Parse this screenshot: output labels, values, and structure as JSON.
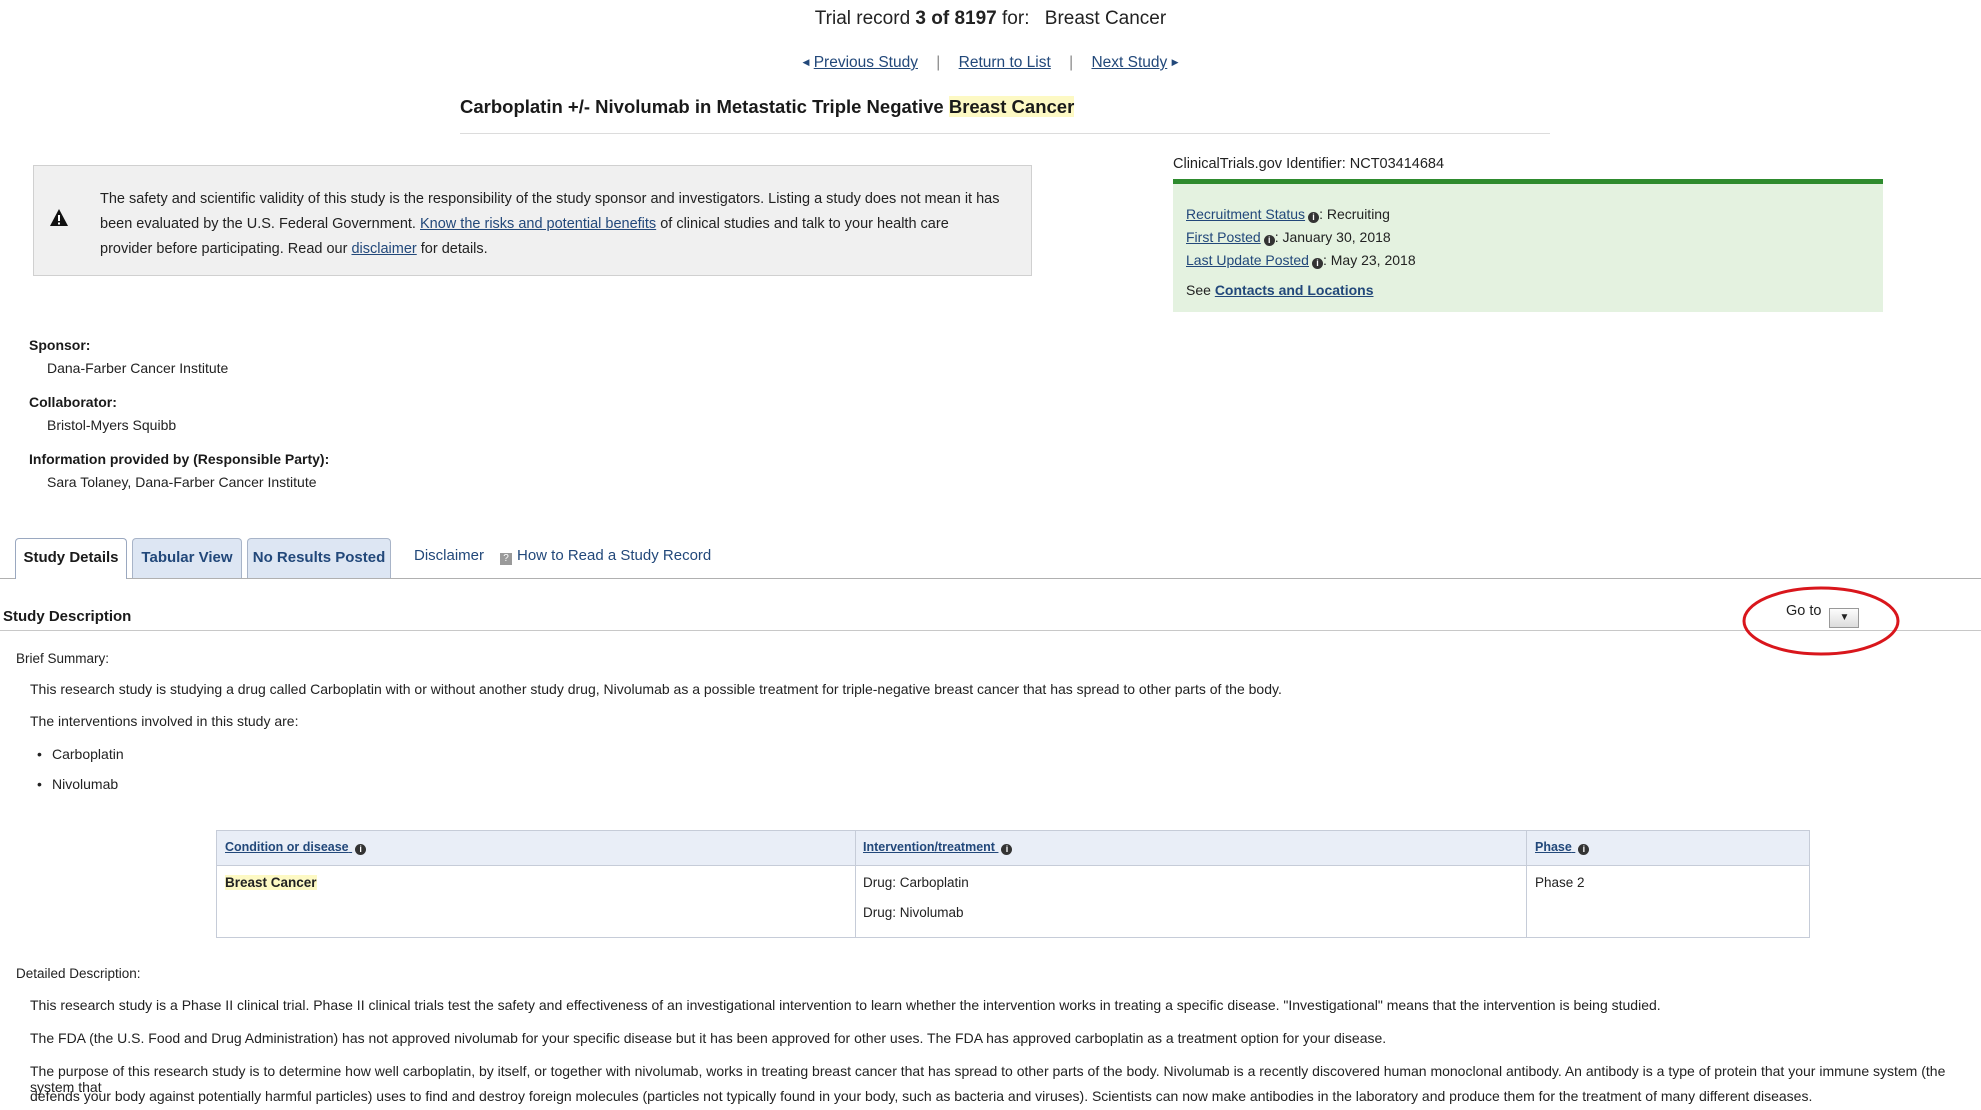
{
  "header": {
    "trial_prefix": "Trial record",
    "trial_count": "3 of 8197",
    "trial_for": "for:",
    "query": "Breast Cancer",
    "nav": {
      "previous": "Previous Study",
      "return": "Return to List",
      "next": "Next Study"
    },
    "title_main": "Carboplatin +/- Nivolumab in Metastatic Triple Negative",
    "title_highlight": "Breast Cancer"
  },
  "disclaimer": {
    "text_1": "The safety and scientific validity of this study is the responsibility of the study sponsor and investigators. Listing a study does not mean it has been evaluated by the U.S. Federal Government.",
    "link_risks": "Know the risks and potential benefits",
    "text_2": "of clinical studies and talk to your health care provider before participating. Read our",
    "link_disclaimer": "disclaimer",
    "text_3": "for details."
  },
  "status": {
    "identifier_label": "ClinicalTrials.gov Identifier:",
    "identifier": "NCT03414684",
    "recruitment_label": "Recruitment Status",
    "recruitment_value": "Recruiting",
    "first_posted_label": "First Posted",
    "first_posted_value": "January 30, 2018",
    "last_update_label": "Last Update Posted",
    "last_update_value": "May 23, 2018",
    "see_label": "See",
    "contacts_link": "Contacts and Locations"
  },
  "sponsor": {
    "sponsor_label": "Sponsor:",
    "sponsor_value": "Dana-Farber Cancer Institute",
    "collaborator_label": "Collaborator:",
    "collaborator_value": "Bristol-Myers Squibb",
    "info_label": "Information provided by (Responsible Party):",
    "info_value": "Sara Tolaney, Dana-Farber Cancer Institute"
  },
  "tabs": {
    "details": "Study Details",
    "tabular": "Tabular View",
    "results": "No Results Posted",
    "disclaimer": "Disclaimer",
    "howto": "How to Read a Study Record"
  },
  "description": {
    "section_title": "Study Description",
    "goto_label": "Go to",
    "brief_label": "Brief Summary:",
    "brief_text": "This research study is studying a drug called Carboplatin with or without another study drug, Nivolumab as a possible treatment for triple-negative breast cancer that has spread to other parts of the body.",
    "interventions_intro": "The interventions involved in this study are:",
    "interventions": [
      "Carboplatin",
      "Nivolumab"
    ],
    "detailed_label": "Detailed Description:",
    "detailed_p1": "This research study is a Phase II clinical trial. Phase II clinical trials test the safety and effectiveness of an investigational intervention to learn whether the intervention works in treating a specific disease. \"Investigational\" means that the intervention is being studied.",
    "detailed_p2": "The FDA (the U.S. Food and Drug Administration) has not approved nivolumab for your specific disease but it has been approved for other uses. The FDA has approved carboplatin as a treatment option for your disease.",
    "detailed_p3_line1": "The purpose of this research study is to determine how well carboplatin, by itself, or together with nivolumab, works in treating breast cancer that has spread to other parts of the body. Nivolumab is a recently discovered human monoclonal antibody. An antibody is a type of protein that your immune system (the system that",
    "detailed_p3_line2": "defends your body against potentially harmful particles) uses to find and destroy foreign molecules (particles not typically found in your body, such as bacteria and viruses). Scientists can now make antibodies in the laboratory and produce them for the treatment of many different diseases."
  },
  "conditions_table": {
    "headers": [
      "Condition or disease",
      "Intervention/treatment",
      "Phase"
    ],
    "condition": "Breast Cancer",
    "interventions": [
      "Drug: Carboplatin",
      "Drug: Nivolumab"
    ],
    "phase": "Phase 2"
  },
  "colors": {
    "link": "#22487a",
    "status_border": "#2e8b2e",
    "status_bg": "#e4f2e0",
    "highlight": "#fdf9c4",
    "annotation": "#d9161c"
  }
}
